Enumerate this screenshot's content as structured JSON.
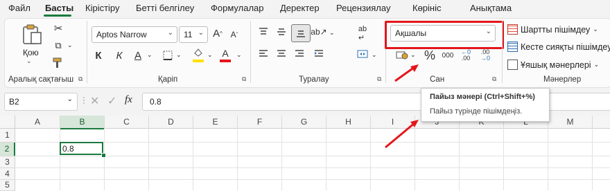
{
  "menu": {
    "tabs": [
      "Файл",
      "Басты",
      "Кірістіру",
      "Бетті белгілеу",
      "Формулалар",
      "Деректер",
      "Рецензиялау",
      "Көрініс",
      "Анықтама"
    ],
    "active_tab": "Басты"
  },
  "ribbon": {
    "clipboard": {
      "paste_label": "Қою",
      "group_label": "Аралық сақтағыш"
    },
    "font": {
      "name": "Aptos Narrow",
      "size": "11",
      "group_label": "Қаріп",
      "bold": "К",
      "italic": "К",
      "underline": "А",
      "font_color_letter": "А",
      "grow": "A",
      "shrink": "A"
    },
    "alignment": {
      "group_label": "Туралау"
    },
    "number": {
      "format_value": "Ақшалы",
      "percent_symbol": "%",
      "comma_symbol": "000",
      "inc_decimal": "←0 .00",
      "dec_decimal": ".00 →0",
      "group_label": "Сан"
    },
    "styles": {
      "conditional": "Шартты пішімдеу",
      "as_table": "Кесте сияқты пішімдеу",
      "cell_styles": "Ұяшық мәнерлері",
      "group_label": "Мәнерлер"
    }
  },
  "formula_bar": {
    "name_box": "B2",
    "fx": "fx",
    "content": "0.8"
  },
  "grid": {
    "columns": [
      "A",
      "B",
      "C",
      "D",
      "E",
      "F",
      "G",
      "H",
      "I",
      "J",
      "K",
      "L",
      "M"
    ],
    "rows": [
      "1",
      "2",
      "3",
      "4",
      "5"
    ],
    "cell_B2": "0.8"
  },
  "tooltip": {
    "title": "Пайыз мәнері (Ctrl+Shift+%)",
    "body": "Пайыз түрінде пішімдеңіз."
  },
  "colors": {
    "accent": "#1a7a3e",
    "highlight_red": "#e3161b",
    "fill_yellow": "#ffe000",
    "font_red": "#e3161b"
  }
}
